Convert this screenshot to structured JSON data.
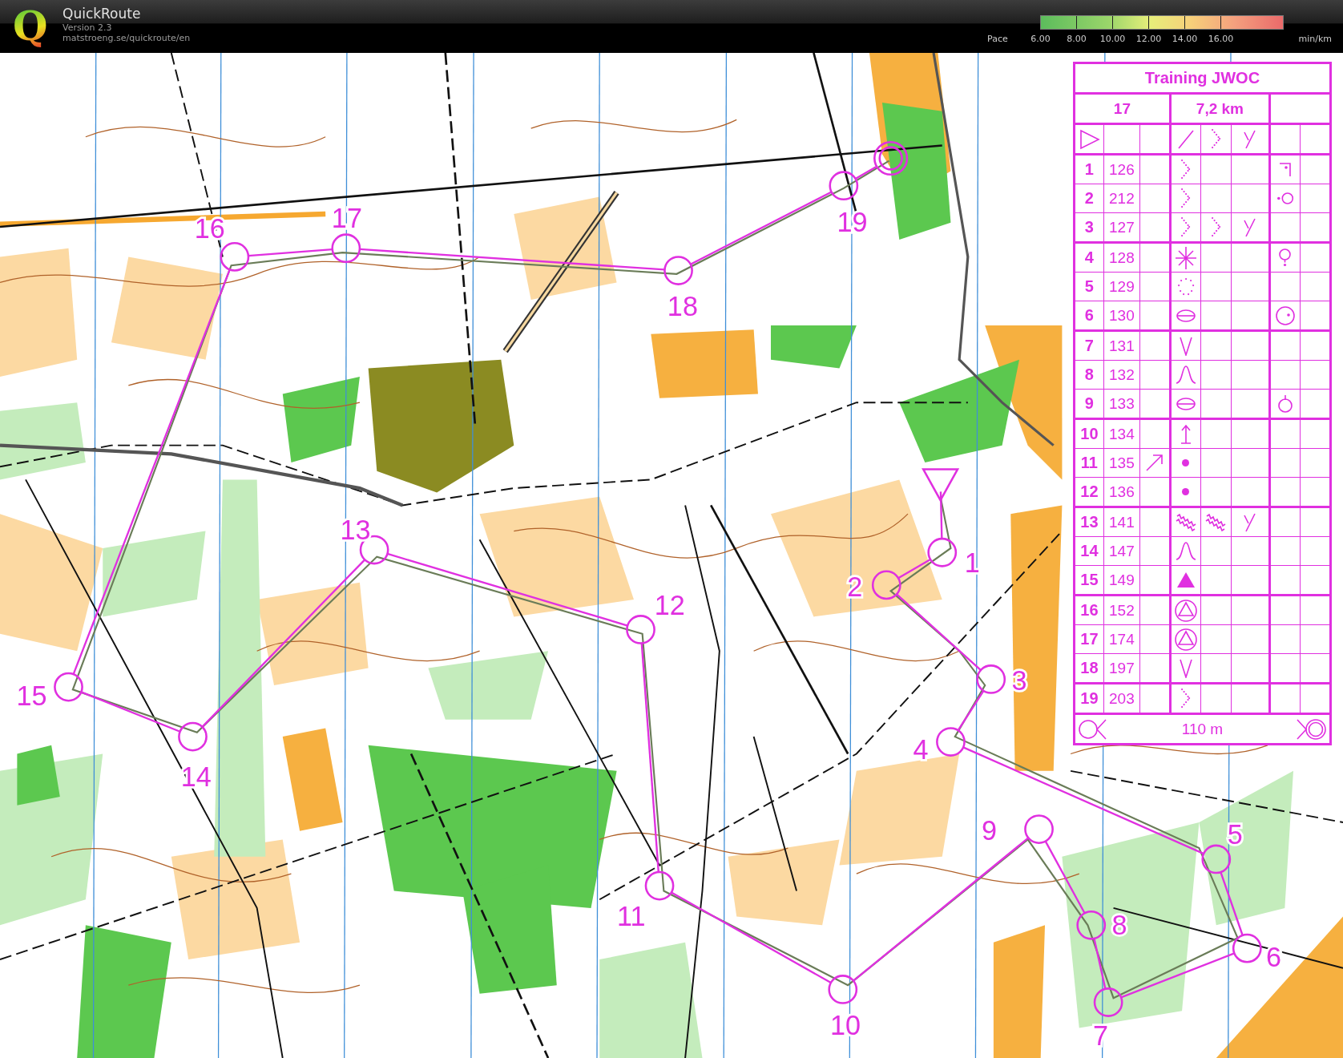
{
  "header": {
    "logo": "Q",
    "title": "QuickRoute",
    "version": "Version 2.3",
    "url": "matstroeng.se/quickroute/en"
  },
  "pace_legend": {
    "label": "Pace",
    "ticks": [
      "6.00",
      "8.00",
      "10.00",
      "12.00",
      "14.00",
      "16.00"
    ],
    "unit": "min/km"
  },
  "map": {
    "controls": [
      {
        "number": "1"
      },
      {
        "number": "2"
      },
      {
        "number": "3"
      },
      {
        "number": "4"
      },
      {
        "number": "5"
      },
      {
        "number": "6"
      },
      {
        "number": "7"
      },
      {
        "number": "8"
      },
      {
        "number": "9"
      },
      {
        "number": "10"
      },
      {
        "number": "11"
      },
      {
        "number": "12"
      },
      {
        "number": "13"
      },
      {
        "number": "14"
      },
      {
        "number": "15"
      },
      {
        "number": "16"
      },
      {
        "number": "17"
      },
      {
        "number": "18"
      },
      {
        "number": "19"
      }
    ]
  },
  "description_sheet": {
    "title": "Training JWOC",
    "course": "17",
    "length": "7,2 km",
    "start_row": {
      "cells": [
        {
          "kind": "empty"
        },
        {
          "kind": "line"
        },
        {
          "kind": "chevron"
        },
        {
          "kind": "junction"
        },
        {
          "kind": "empty"
        },
        {
          "kind": "empty"
        }
      ]
    },
    "rows": [
      {
        "number": "1",
        "code": "126",
        "cells": [
          {
            "kind": "empty"
          },
          {
            "kind": "chevron"
          },
          {
            "kind": "empty"
          },
          {
            "kind": "empty"
          },
          {
            "kind": "corner"
          },
          {
            "kind": "empty"
          }
        ]
      },
      {
        "number": "2",
        "code": "212",
        "cells": [
          {
            "kind": "empty"
          },
          {
            "kind": "chevron"
          },
          {
            "kind": "empty"
          },
          {
            "kind": "empty"
          },
          {
            "kind": "westside"
          },
          {
            "kind": "empty"
          }
        ]
      },
      {
        "number": "3",
        "code": "127",
        "cells": [
          {
            "kind": "empty"
          },
          {
            "kind": "chevron"
          },
          {
            "kind": "chevron"
          },
          {
            "kind": "junction"
          },
          {
            "kind": "empty"
          },
          {
            "kind": "empty"
          }
        ]
      },
      {
        "number": "4",
        "code": "128",
        "cells": [
          {
            "kind": "empty"
          },
          {
            "kind": "asterisk"
          },
          {
            "kind": "empty"
          },
          {
            "kind": "empty"
          },
          {
            "kind": "foot"
          },
          {
            "kind": "empty"
          }
        ]
      },
      {
        "number": "5",
        "code": "129",
        "cells": [
          {
            "kind": "empty"
          },
          {
            "kind": "ring"
          },
          {
            "kind": "empty"
          },
          {
            "kind": "empty"
          },
          {
            "kind": "empty"
          },
          {
            "kind": "empty"
          }
        ]
      },
      {
        "number": "6",
        "code": "130",
        "cells": [
          {
            "kind": "empty"
          },
          {
            "kind": "ellipse"
          },
          {
            "kind": "empty"
          },
          {
            "kind": "empty"
          },
          {
            "kind": "eastside"
          },
          {
            "kind": "empty"
          }
        ]
      },
      {
        "number": "7",
        "code": "131",
        "cells": [
          {
            "kind": "empty"
          },
          {
            "kind": "vee"
          },
          {
            "kind": "empty"
          },
          {
            "kind": "empty"
          },
          {
            "kind": "empty"
          },
          {
            "kind": "empty"
          }
        ]
      },
      {
        "number": "8",
        "code": "132",
        "cells": [
          {
            "kind": "empty"
          },
          {
            "kind": "bell"
          },
          {
            "kind": "empty"
          },
          {
            "kind": "empty"
          },
          {
            "kind": "empty"
          },
          {
            "kind": "empty"
          }
        ]
      },
      {
        "number": "9",
        "code": "133",
        "cells": [
          {
            "kind": "empty"
          },
          {
            "kind": "ellipse"
          },
          {
            "kind": "empty"
          },
          {
            "kind": "empty"
          },
          {
            "kind": "top"
          },
          {
            "kind": "empty"
          }
        ]
      },
      {
        "number": "10",
        "code": "134",
        "cells": [
          {
            "kind": "empty"
          },
          {
            "kind": "arrowbar"
          },
          {
            "kind": "empty"
          },
          {
            "kind": "empty"
          },
          {
            "kind": "empty"
          },
          {
            "kind": "empty"
          }
        ]
      },
      {
        "number": "11",
        "code": "135",
        "cells": [
          {
            "kind": "northeast"
          },
          {
            "kind": "dot"
          },
          {
            "kind": "empty"
          },
          {
            "kind": "empty"
          },
          {
            "kind": "empty"
          },
          {
            "kind": "empty"
          }
        ]
      },
      {
        "number": "12",
        "code": "136",
        "cells": [
          {
            "kind": "empty"
          },
          {
            "kind": "dot"
          },
          {
            "kind": "empty"
          },
          {
            "kind": "empty"
          },
          {
            "kind": "empty"
          },
          {
            "kind": "empty"
          }
        ]
      },
      {
        "number": "13",
        "code": "141",
        "cells": [
          {
            "kind": "empty"
          },
          {
            "kind": "zigzag"
          },
          {
            "kind": "zigzag"
          },
          {
            "kind": "junction"
          },
          {
            "kind": "empty"
          },
          {
            "kind": "empty"
          }
        ]
      },
      {
        "number": "14",
        "code": "147",
        "cells": [
          {
            "kind": "empty"
          },
          {
            "kind": "bell"
          },
          {
            "kind": "empty"
          },
          {
            "kind": "empty"
          },
          {
            "kind": "empty"
          },
          {
            "kind": "empty"
          }
        ]
      },
      {
        "number": "15",
        "code": "149",
        "cells": [
          {
            "kind": "empty"
          },
          {
            "kind": "triangle"
          },
          {
            "kind": "empty"
          },
          {
            "kind": "empty"
          },
          {
            "kind": "empty"
          },
          {
            "kind": "empty"
          }
        ]
      },
      {
        "number": "16",
        "code": "152",
        "cells": [
          {
            "kind": "empty"
          },
          {
            "kind": "circletriangle"
          },
          {
            "kind": "empty"
          },
          {
            "kind": "empty"
          },
          {
            "kind": "empty"
          },
          {
            "kind": "empty"
          }
        ]
      },
      {
        "number": "17",
        "code": "174",
        "cells": [
          {
            "kind": "empty"
          },
          {
            "kind": "circletriangle"
          },
          {
            "kind": "empty"
          },
          {
            "kind": "empty"
          },
          {
            "kind": "empty"
          },
          {
            "kind": "empty"
          }
        ]
      },
      {
        "number": "18",
        "code": "197",
        "cells": [
          {
            "kind": "empty"
          },
          {
            "kind": "vee"
          },
          {
            "kind": "empty"
          },
          {
            "kind": "empty"
          },
          {
            "kind": "empty"
          },
          {
            "kind": "empty"
          }
        ]
      },
      {
        "number": "19",
        "code": "203",
        "cells": [
          {
            "kind": "empty"
          },
          {
            "kind": "chevron"
          },
          {
            "kind": "empty"
          },
          {
            "kind": "empty"
          },
          {
            "kind": "empty"
          },
          {
            "kind": "empty"
          }
        ]
      }
    ],
    "finish_row": {
      "distance": "110 m"
    }
  }
}
